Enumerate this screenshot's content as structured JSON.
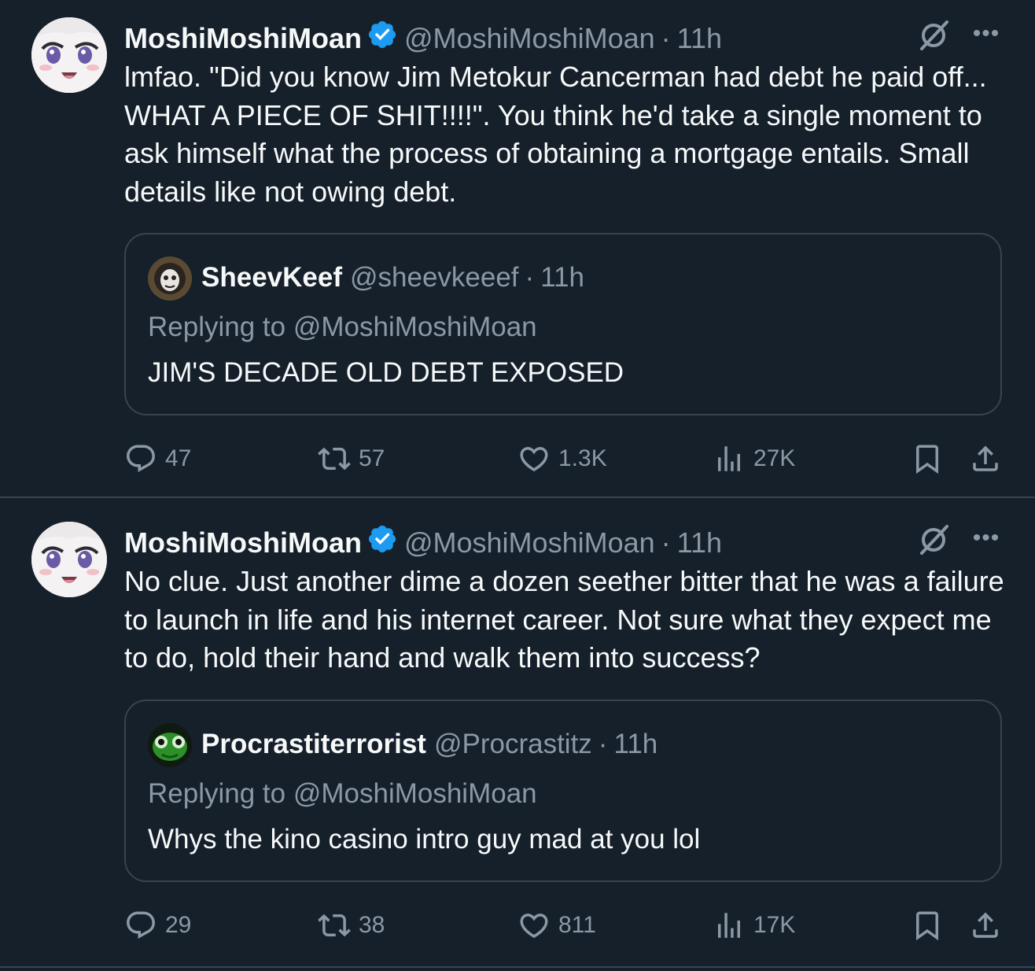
{
  "tweets": [
    {
      "name": "MoshiMoshiMoan",
      "handle": "@MoshiMoshiMoan",
      "sep": "·",
      "time": "11h",
      "text": "lmfao.  \"Did you know Jim Metokur Cancerman had debt he paid off... WHAT A PIECE OF SHIT!!!!\".  You think he'd take a single moment to ask himself what the process of obtaining a mortgage entails.  Small details like not owing debt.",
      "quote": {
        "name": "SheevKeef",
        "handle": "@sheevkeeef",
        "sep": "·",
        "time": "11h",
        "replying": "Replying to @MoshiMoshiMoan",
        "text": "JIM'S DECADE OLD DEBT EXPOSED"
      },
      "actions": {
        "replies": "47",
        "reposts": "57",
        "likes": "1.3K",
        "views": "27K"
      }
    },
    {
      "name": "MoshiMoshiMoan",
      "handle": "@MoshiMoshiMoan",
      "sep": "·",
      "time": "11h",
      "text": "No clue.  Just another dime a dozen seether bitter that he was a failure to launch in life and his internet career.  Not sure what they expect me to do, hold their hand and walk them into success?",
      "quote": {
        "name": "Procrastiterrorist",
        "handle": "@Procrastitz",
        "sep": "·",
        "time": "11h",
        "replying": "Replying to @MoshiMoshiMoan",
        "text": "Whys the kino casino intro guy mad at you lol"
      },
      "actions": {
        "replies": "29",
        "reposts": "38",
        "likes": "811",
        "views": "17K"
      }
    }
  ],
  "icons": {
    "verified": "verified-badge-icon",
    "grok": "grok-icon",
    "more": "more-icon",
    "reply": "reply-icon",
    "repost": "repost-icon",
    "like": "like-icon",
    "views": "views-icon",
    "bookmark": "bookmark-icon",
    "share": "share-icon"
  },
  "colors": {
    "background": "#15202b",
    "text": "#f7f9f9",
    "muted": "#8b98a5",
    "border": "#38444d",
    "verified": "#1d9bf0"
  }
}
